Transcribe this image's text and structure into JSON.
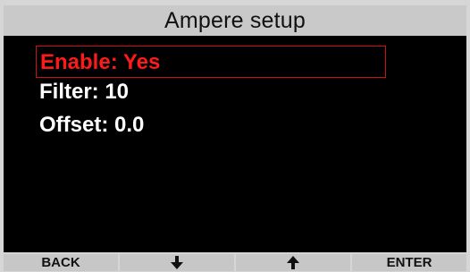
{
  "title": "Ampere setup",
  "menu": {
    "items": [
      {
        "label": "Enable: Yes",
        "selected": true
      },
      {
        "label": "Filter: 10",
        "selected": false
      },
      {
        "label": "Offset: 0.0",
        "selected": false
      }
    ]
  },
  "softkeys": {
    "back_label": "BACK",
    "down_icon": "arrow-down-icon",
    "up_icon": "arrow-up-icon",
    "enter_label": "ENTER"
  },
  "colors": {
    "selected_text": "#ff1a1a",
    "selection_border": "#d01010",
    "screen_background": "#000000",
    "bar_background": "#c9c9c9"
  }
}
